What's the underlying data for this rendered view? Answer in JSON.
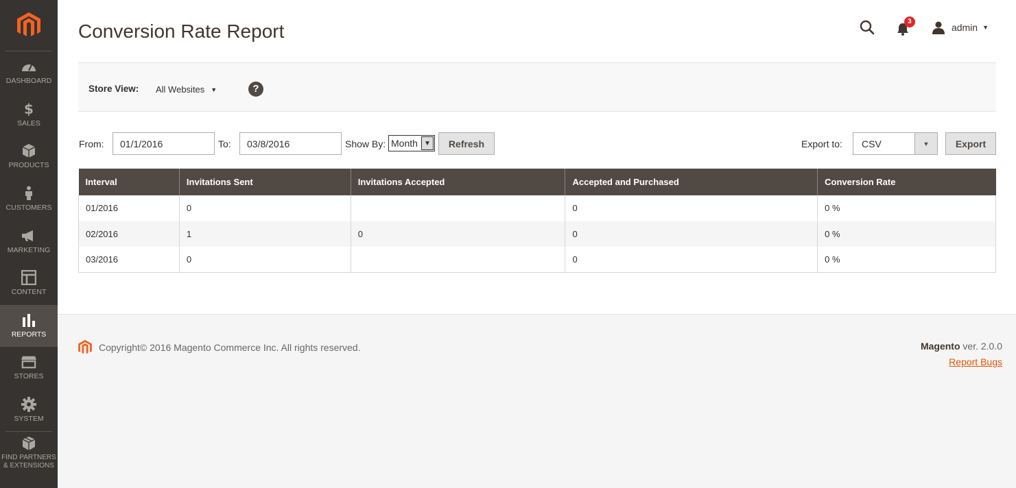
{
  "sidebar": {
    "items": [
      {
        "label": "DASHBOARD",
        "icon": "gauge-icon"
      },
      {
        "label": "SALES",
        "icon": "dollar-icon"
      },
      {
        "label": "PRODUCTS",
        "icon": "box-icon"
      },
      {
        "label": "CUSTOMERS",
        "icon": "person-icon"
      },
      {
        "label": "MARKETING",
        "icon": "megaphone-icon"
      },
      {
        "label": "CONTENT",
        "icon": "layout-icon"
      },
      {
        "label": "REPORTS",
        "icon": "bar-chart-icon"
      },
      {
        "label": "STORES",
        "icon": "store-icon"
      },
      {
        "label": "SYSTEM",
        "icon": "gear-icon"
      },
      {
        "label": "FIND PARTNERS & EXTENSIONS",
        "icon": "blocks-icon"
      }
    ],
    "active": "REPORTS"
  },
  "header": {
    "title": "Conversion Rate Report",
    "notifications_count": "3",
    "user": "admin"
  },
  "store_view": {
    "label": "Store View:",
    "value": "All Websites"
  },
  "filters": {
    "from_label": "From:",
    "from_value": "01/1/2016",
    "to_label": "To:",
    "to_value": "03/8/2016",
    "showby_label": "Show By:",
    "showby_value": "Month",
    "refresh_label": "Refresh",
    "export_label": "Export to:",
    "export_value": "CSV",
    "export_button": "Export"
  },
  "table": {
    "headers": [
      "Interval",
      "Invitations Sent",
      "Invitations Accepted",
      "Accepted and Purchased",
      "Conversion Rate"
    ],
    "rows": [
      [
        "01/2016",
        "0",
        "",
        "0",
        "0 %"
      ],
      [
        "02/2016",
        "1",
        "0",
        "0",
        "0 %"
      ],
      [
        "03/2016",
        "0",
        "",
        "0",
        "0 %"
      ]
    ]
  },
  "footer": {
    "copyright": "Copyright© 2016 Magento Commerce Inc. All rights reserved.",
    "brand": "Magento",
    "version": " ver. 2.0.0",
    "report_bugs": "Report Bugs"
  },
  "colors": {
    "accent": "#eb5202",
    "sidebar_bg": "#373330",
    "table_header_bg": "#514943"
  }
}
